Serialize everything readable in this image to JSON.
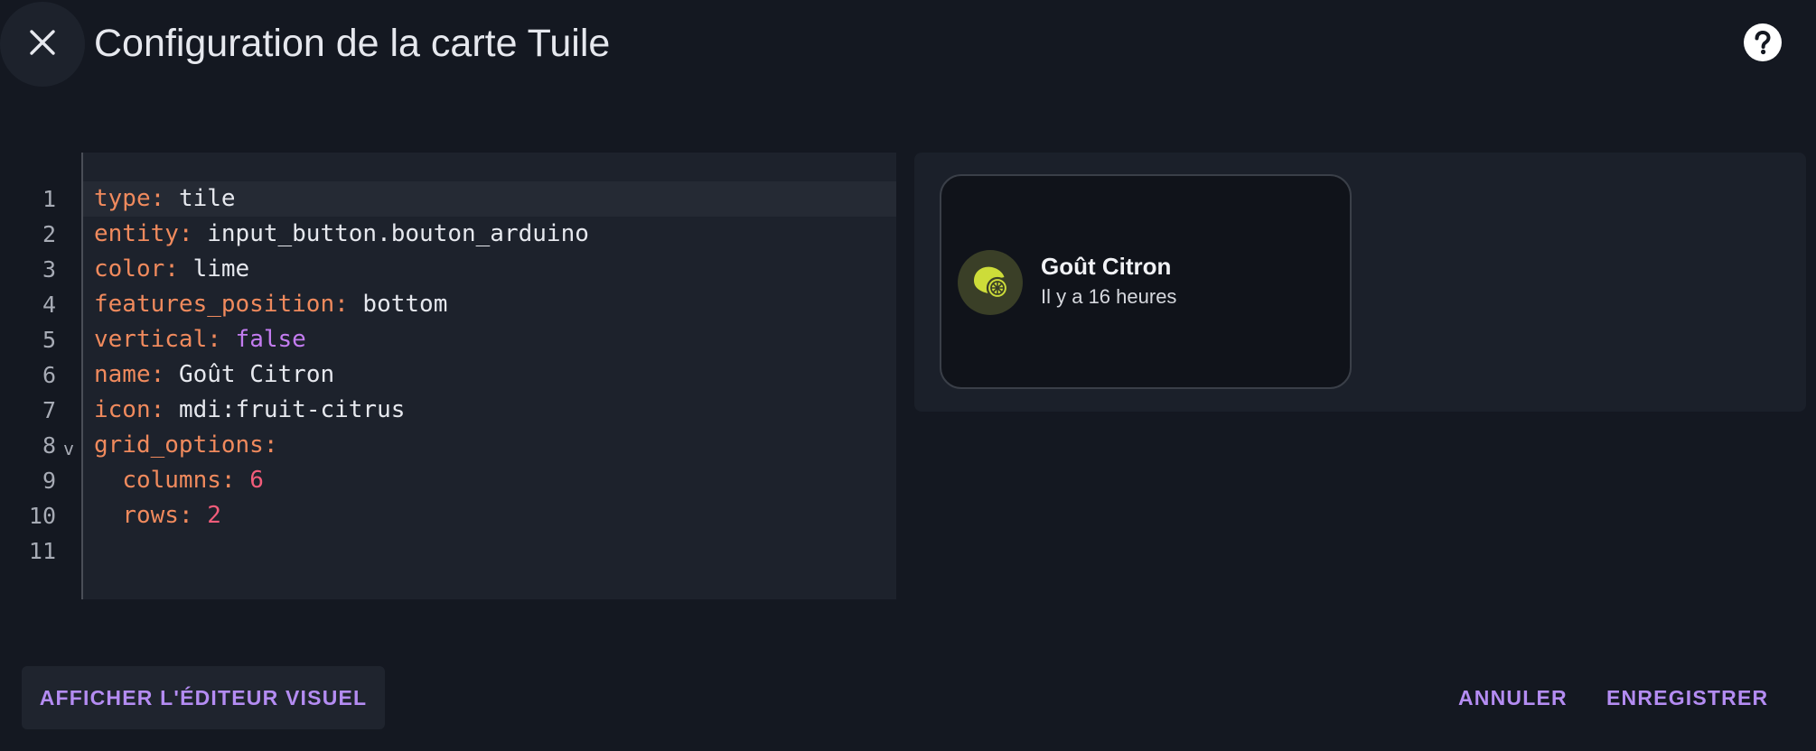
{
  "dialog": {
    "title": "Configuration de la carte Tuile"
  },
  "icons": {
    "close": "close-icon",
    "help": "help-circle-icon",
    "tile": "fruit-citrus-icon"
  },
  "editor": {
    "lines": [
      {
        "number": "1",
        "key": "type",
        "sep": ": ",
        "value": "tile",
        "value_type": "string",
        "indent": 0
      },
      {
        "number": "2",
        "key": "entity",
        "sep": ": ",
        "value": "input_button.bouton_arduino",
        "value_type": "string",
        "indent": 0
      },
      {
        "number": "3",
        "key": "color",
        "sep": ": ",
        "value": "lime",
        "value_type": "string",
        "indent": 0
      },
      {
        "number": "4",
        "key": "features_position",
        "sep": ": ",
        "value": "bottom",
        "value_type": "string",
        "indent": 0
      },
      {
        "number": "5",
        "key": "vertical",
        "sep": ": ",
        "value": "false",
        "value_type": "bool",
        "indent": 0
      },
      {
        "number": "6",
        "key": "name",
        "sep": ": ",
        "value": "Goût Citron",
        "value_type": "string",
        "indent": 0
      },
      {
        "number": "7",
        "key": "icon",
        "sep": ": ",
        "value": "mdi:fruit-citrus",
        "value_type": "string",
        "indent": 0
      },
      {
        "number": "8",
        "key": "grid_options",
        "sep": ":",
        "value": "",
        "value_type": "none",
        "indent": 0,
        "fold": "v"
      },
      {
        "number": "9",
        "key": "columns",
        "sep": ": ",
        "value": "6",
        "value_type": "number",
        "indent": 2
      },
      {
        "number": "10",
        "key": "rows",
        "sep": ": ",
        "value": "2",
        "value_type": "number",
        "indent": 2
      },
      {
        "number": "11",
        "key": "",
        "sep": "",
        "value": "",
        "value_type": "none",
        "indent": 0
      }
    ]
  },
  "preview": {
    "tile": {
      "name": "Goût Citron",
      "state": "Il y a 16 heures",
      "accent_color": "#cddc39",
      "icon_bg": "#3a3f27"
    }
  },
  "footer": {
    "visual_editor_label": "AFFICHER L'ÉDITEUR VISUEL",
    "cancel_label": "ANNULER",
    "save_label": "ENREGISTRER"
  },
  "colors": {
    "background": "#141821",
    "accent": "#b48cf2",
    "yaml_key": "#f08a5d",
    "yaml_bool": "#c37cf0",
    "yaml_number": "#f25c7a"
  }
}
